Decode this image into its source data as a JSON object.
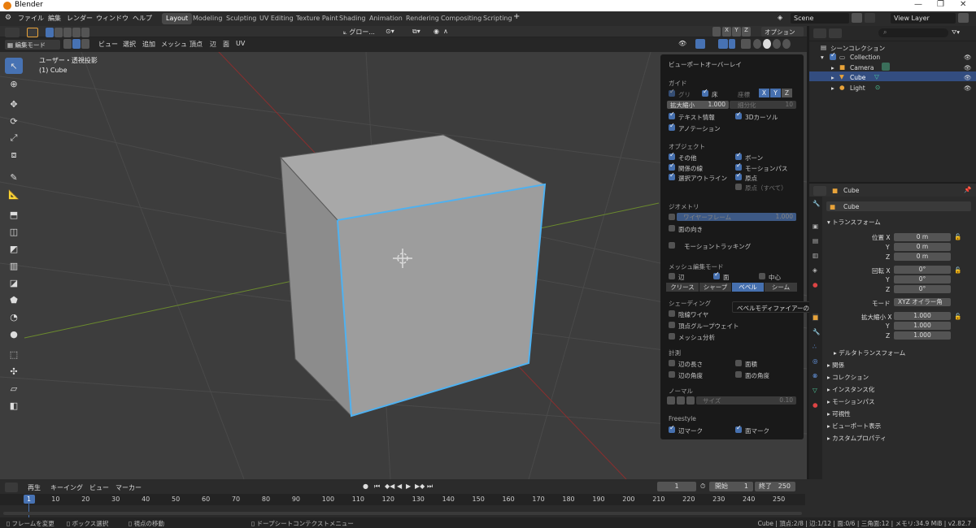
{
  "app_title": "Blender",
  "menu": [
    "ファイル",
    "編集",
    "レンダー",
    "ウィンドウ",
    "ヘルプ"
  ],
  "workspaces": [
    "Layout",
    "Modeling",
    "Sculpting",
    "UV Editing",
    "Texture Paint",
    "Shading",
    "Animation",
    "Rendering",
    "Compositing",
    "Scripting"
  ],
  "active_workspace": "Layout",
  "scene": "Scene",
  "view_layer": "View Layer",
  "header": {
    "transform_orientation": "グロー...",
    "mode": "編集モード",
    "menus": [
      "ビュー",
      "選択",
      "追加",
      "メッシュ",
      "頂点",
      "辺",
      "面",
      "UV"
    ],
    "options": "オプション",
    "axes": [
      "X",
      "Y",
      "Z"
    ]
  },
  "viewport": {
    "title": "ユーザー・透視投影",
    "object": "(1) Cube"
  },
  "overlay": {
    "title": "ビューポートオーバーレイ",
    "guides_label": "ガイド",
    "grid": "グリ",
    "floor": "床",
    "axis_label": "座標",
    "axes": [
      "X",
      "Y",
      "Z"
    ],
    "scale_label": "拡大縮小",
    "scale_value": "1.000",
    "subdiv_label": "細分化",
    "subdiv_value": "10",
    "text_info": "テキスト情報",
    "cursor3d": "3Dカーソル",
    "annotation": "アノテーション",
    "objects_label": "オブジェクト",
    "extras": "その他",
    "bones": "ボーン",
    "relations": "関係の線",
    "motion_paths": "モーションパス",
    "outline": "選択アウトライン",
    "origins": "原点",
    "origins_all": "原点（すべて）",
    "geometry_label": "ジオメトリ",
    "wireframe": "ワイヤーフレーム",
    "wireframe_value": "1.000",
    "face_orientation": "面の向き",
    "motion_tracking": "モーショントラッキング",
    "mesh_edit_label": "メッシュ編集モード",
    "edges": "辺",
    "faces": "面",
    "center": "中心",
    "edge_marks": [
      "クリース",
      "シャープ",
      "ベベル",
      "シーム"
    ],
    "active_mark": "ベベル",
    "shading_label": "シェーディング",
    "hidden_wire": "陰線ワイヤ",
    "vertex_group_weights": "頂点グループウェイト",
    "mesh_analysis": "メッシュ分析",
    "measure_label": "計測",
    "edge_length": "辺の長さ",
    "face_area": "面積",
    "edge_angle": "辺の角度",
    "face_angle": "面の角度",
    "normals_label": "ノーマル",
    "size_label": "サイズ",
    "size_value": "0.10",
    "freestyle_label": "Freestyle",
    "edge_mark": "辺マーク",
    "face_mark": "面マーク"
  },
  "tooltip": "ベベルモディファイアーのウェイトを表示します。",
  "outliner": {
    "root": "シーンコレクション",
    "items": [
      {
        "label": "Collection",
        "selected": false
      },
      {
        "label": "Camera",
        "selected": false
      },
      {
        "label": "Cube",
        "selected": true
      },
      {
        "label": "Light",
        "selected": false
      }
    ]
  },
  "properties": {
    "object": "Cube",
    "name": "Cube",
    "transform": "トランスフォーム",
    "location_label": "位置 X",
    "location": [
      "0 m",
      "0 m",
      "0 m"
    ],
    "rotation_label": "回転 X",
    "rotation": [
      "0°",
      "0°",
      "0°"
    ],
    "mode_label": "モード",
    "mode_value": "XYZ オイラー角",
    "scale_label": "拡大縮小 X",
    "scale": [
      "1.000",
      "1.000",
      "1.000"
    ],
    "y": "Y",
    "z": "Z",
    "delta": "デルタトランスフォーム",
    "panels": [
      "関係",
      "コレクション",
      "インスタンス化",
      "モーションパス",
      "可視性",
      "ビューポート表示",
      "カスタムプロパティ"
    ]
  },
  "timeline": {
    "menus": [
      "再生",
      "キーイング",
      "ビュー",
      "マーカー"
    ],
    "current_frame": "1",
    "start_label": "開始",
    "start": "1",
    "end_label": "終了",
    "end": "250",
    "ticks": [
      "1",
      "10",
      "20",
      "30",
      "40",
      "50",
      "60",
      "70",
      "80",
      "90",
      "100",
      "110",
      "120",
      "130",
      "140",
      "150",
      "160",
      "170",
      "180",
      "190",
      "200",
      "210",
      "220",
      "230",
      "240",
      "250"
    ]
  },
  "status": {
    "left": [
      "フレームを変更",
      "ボックス選択",
      "視点の移動",
      "ドープシートコンテクストメニュー"
    ],
    "right": "Cube | 頂点:2/8 | 辺:1/12 | 面:0/6 | 三角面:12 | メモリ:34.9 MiB | v2.82.7"
  }
}
